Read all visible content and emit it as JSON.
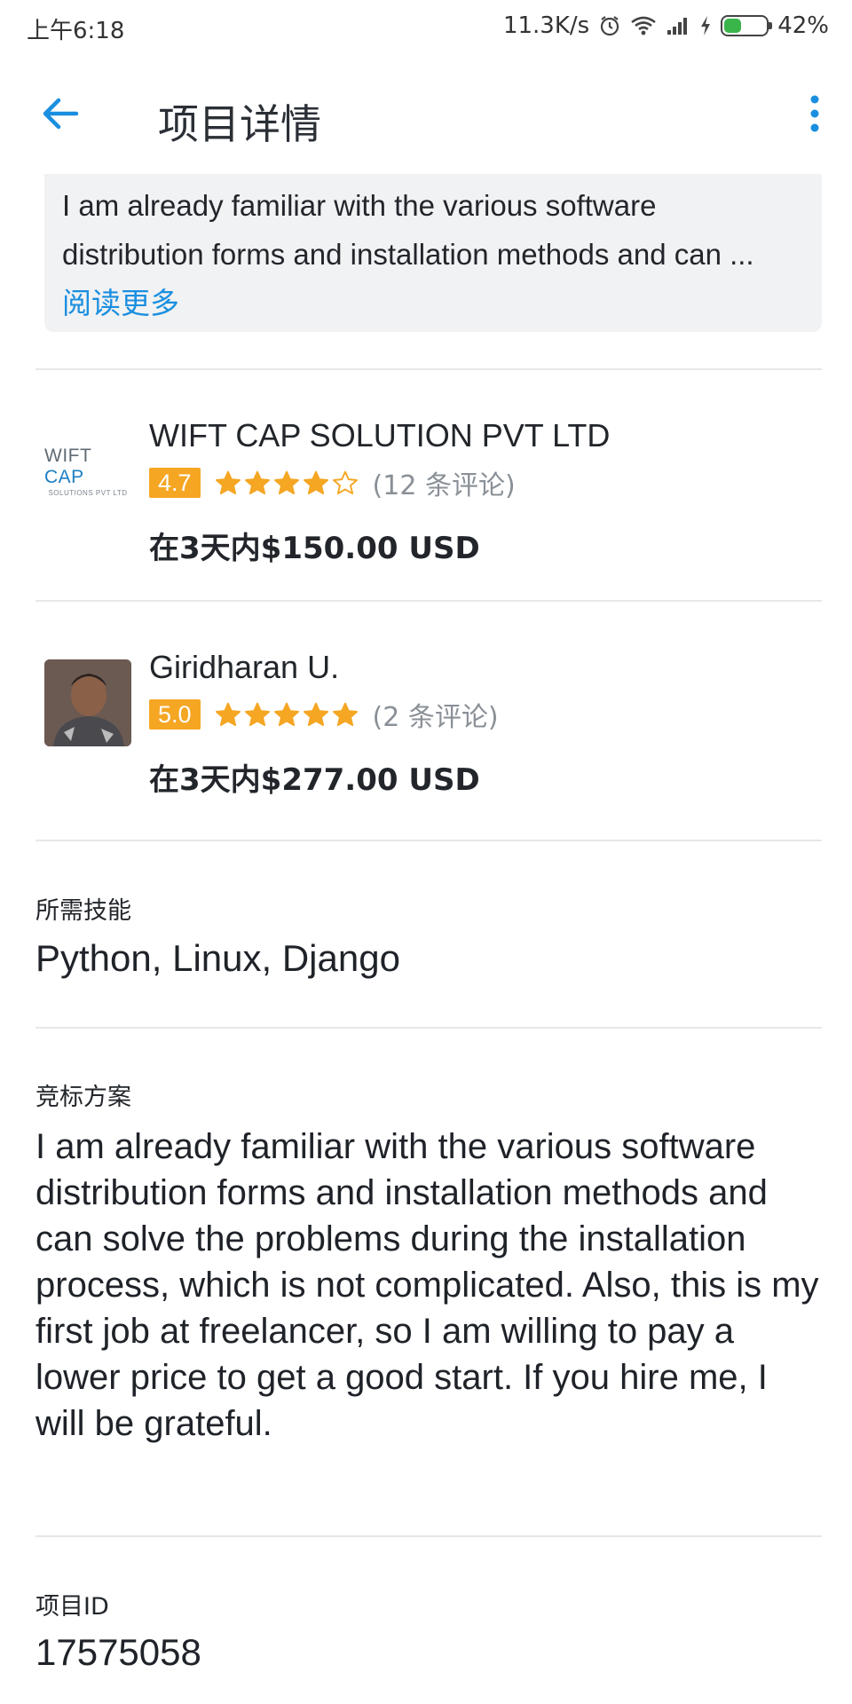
{
  "status_bar": {
    "time": "上午6:18",
    "net_speed": "11.3K/s",
    "battery": "42%",
    "battery_level": 0.42,
    "icons": [
      "alarm-icon",
      "wifi-icon",
      "signal-icon",
      "charging-icon",
      "battery-icon"
    ]
  },
  "app_bar": {
    "title": "项目详情",
    "back_icon": "arrow-left-icon",
    "more_icon": "more-vertical-icon"
  },
  "description": {
    "line1": "I am already familiar with the various software",
    "line2": "distribution forms and installation methods and can ...",
    "read_more": "阅读更多"
  },
  "bids": [
    {
      "name": "WIFT CAP SOLUTION PVT LTD",
      "logo_text": "WIFT",
      "logo_text_accent": "CAP",
      "logo_subtext": "SOLUTIONS PVT LTD",
      "rating": "4.7",
      "stars": 4.7,
      "reviews": "(12 条评论)",
      "price": "在3天内$150.00 USD"
    },
    {
      "name": "Giridharan U.",
      "rating": "5.0",
      "stars": 5,
      "reviews": "(2 条评论)",
      "price": "在3天内$277.00 USD"
    }
  ],
  "skills": {
    "label": "所需技能",
    "value": "Python, Linux, Django"
  },
  "proposal": {
    "label": "竞标方案",
    "text": "I am already familiar with the various software distribution forms and installation methods and can solve the problems during the installation process, which is not complicated. Also, this is my first job at freelancer, so I am willing to pay a lower price to get a good start. If you hire me, I will be grateful."
  },
  "project_id": {
    "label": "项目ID",
    "value": "17575058"
  },
  "colors": {
    "accent": "#1a8fe0",
    "star": "#f5a623",
    "divider": "#e6e7e9",
    "card_bg": "#f1f2f3"
  }
}
